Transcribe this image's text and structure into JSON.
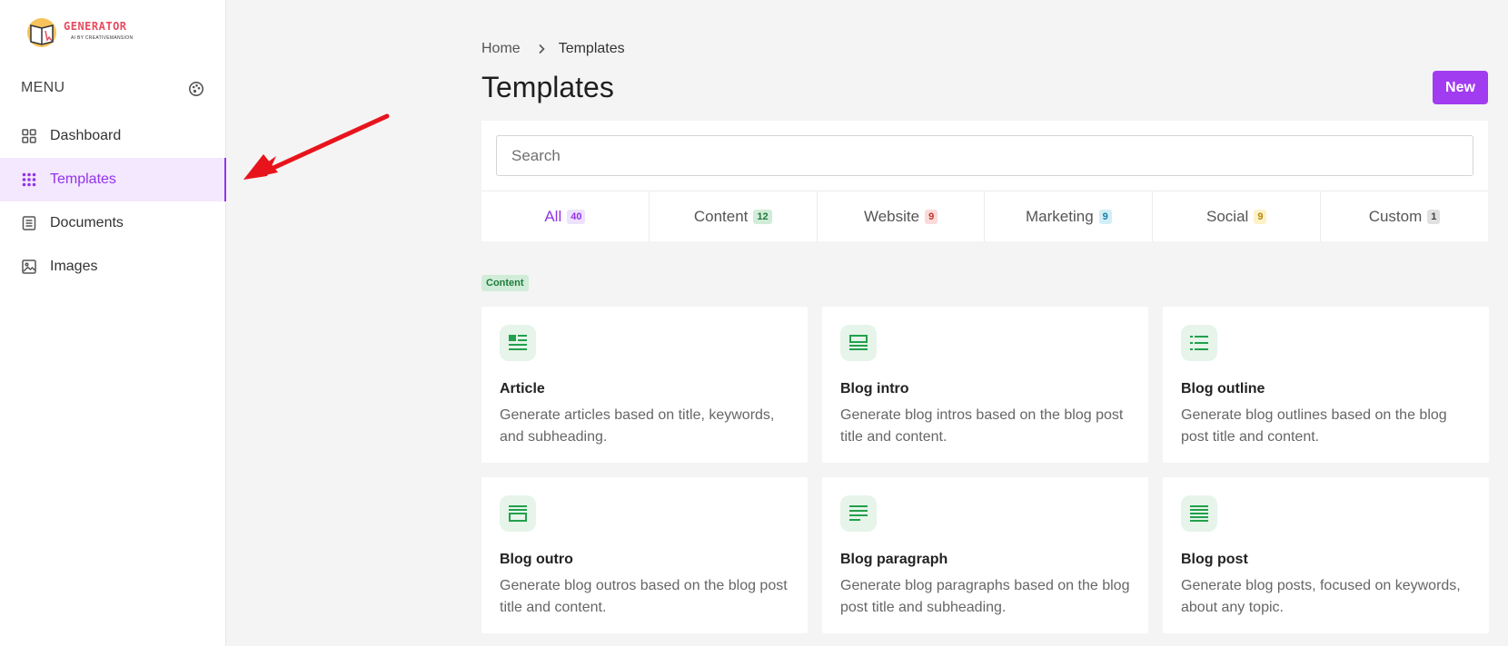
{
  "logo": {
    "word": "GENERATOR",
    "sub": "AI BY CREATIVEMANSION"
  },
  "sidebar": {
    "menu_title": "MENU",
    "items": [
      {
        "label": "Dashboard",
        "icon": "grid-icon",
        "active": false
      },
      {
        "label": "Templates",
        "icon": "dots-grid-icon",
        "active": true
      },
      {
        "label": "Documents",
        "icon": "document-icon",
        "active": false
      },
      {
        "label": "Images",
        "icon": "image-icon",
        "active": false
      }
    ]
  },
  "header": {
    "breadcrumb": [
      "Home",
      "Templates"
    ],
    "title": "Templates",
    "new_label": "New"
  },
  "search": {
    "placeholder": "Search",
    "value": ""
  },
  "tabs": [
    {
      "label": "All",
      "count": "40",
      "badge_bg": "#ede2fd",
      "badge_color": "#9333ea"
    },
    {
      "label": "Content",
      "count": "12",
      "badge_bg": "#d1ecd9",
      "badge_color": "#1e7b3a"
    },
    {
      "label": "Website",
      "count": "9",
      "badge_bg": "#fbdada",
      "badge_color": "#c0392b"
    },
    {
      "label": "Marketing",
      "count": "9",
      "badge_bg": "#d3eef7",
      "badge_color": "#1c7ea8"
    },
    {
      "label": "Social",
      "count": "9",
      "badge_bg": "#fdf1c7",
      "badge_color": "#b7860b"
    },
    {
      "label": "Custom",
      "count": "1",
      "badge_bg": "#e0e0e0",
      "badge_color": "#444444"
    }
  ],
  "section": {
    "label": "Content"
  },
  "cards": [
    {
      "title": "Article",
      "description": "Generate articles based on title, keywords, and subheading.",
      "icon": "article-icon"
    },
    {
      "title": "Blog intro",
      "description": "Generate blog intros based on the blog post title and content.",
      "icon": "blog-intro-icon"
    },
    {
      "title": "Blog outline",
      "description": "Generate blog outlines based on the blog post title and content.",
      "icon": "list-icon"
    },
    {
      "title": "Blog outro",
      "description": "Generate blog outros based on the blog post title and content.",
      "icon": "blog-outro-icon"
    },
    {
      "title": "Blog paragraph",
      "description": "Generate blog paragraphs based on the blog post title and subheading.",
      "icon": "paragraph-icon"
    },
    {
      "title": "Blog post",
      "description": "Generate blog posts, focused on keywords, about any topic.",
      "icon": "text-lines-icon"
    }
  ],
  "colors": {
    "accent": "#9333ea",
    "new_button": "#a23cf0",
    "icon_green": "#22a04b",
    "arrow": "#e8141c"
  }
}
